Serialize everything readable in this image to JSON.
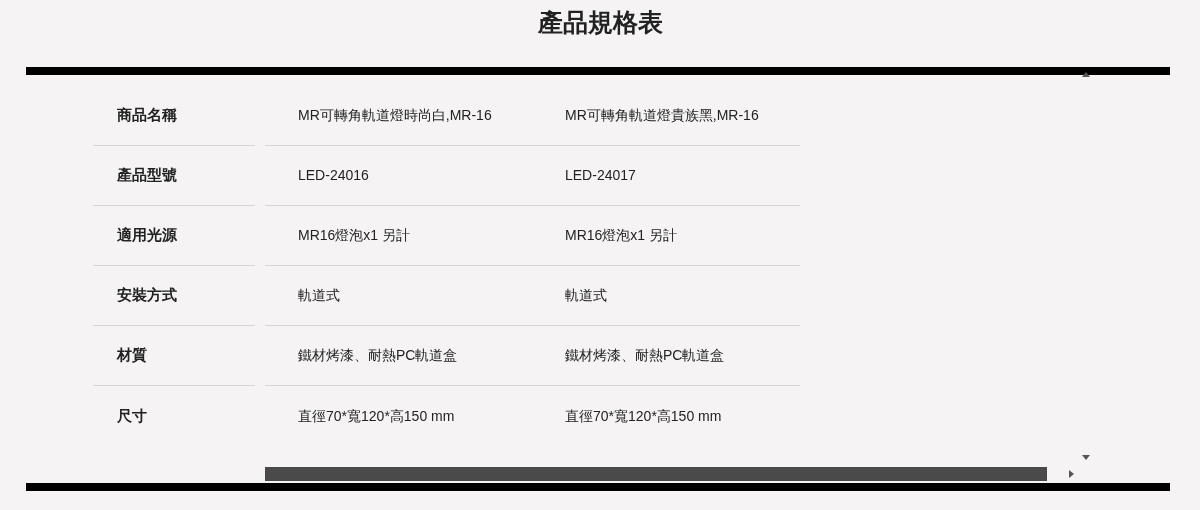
{
  "title": "產品規格表",
  "rows": [
    {
      "label": "商品名稱",
      "values": [
        "MR可轉角軌道燈時尚白,MR-16",
        "MR可轉角軌道燈貴族黑,MR-16"
      ]
    },
    {
      "label": "產品型號",
      "values": [
        "LED-24016",
        "LED-24017"
      ]
    },
    {
      "label": "適用光源",
      "values": [
        "MR16燈泡x1 另計",
        "MR16燈泡x1 另計"
      ]
    },
    {
      "label": "安裝方式",
      "values": [
        "軌道式",
        "軌道式"
      ]
    },
    {
      "label": "材質",
      "values": [
        "鐵材烤漆、耐熱PC軌道盒",
        "鐵材烤漆、耐熱PC軌道盒"
      ]
    },
    {
      "label": "尺寸",
      "values": [
        "直徑70*寬120*高150 mm",
        "直徑70*寬120*高150 mm"
      ]
    }
  ]
}
